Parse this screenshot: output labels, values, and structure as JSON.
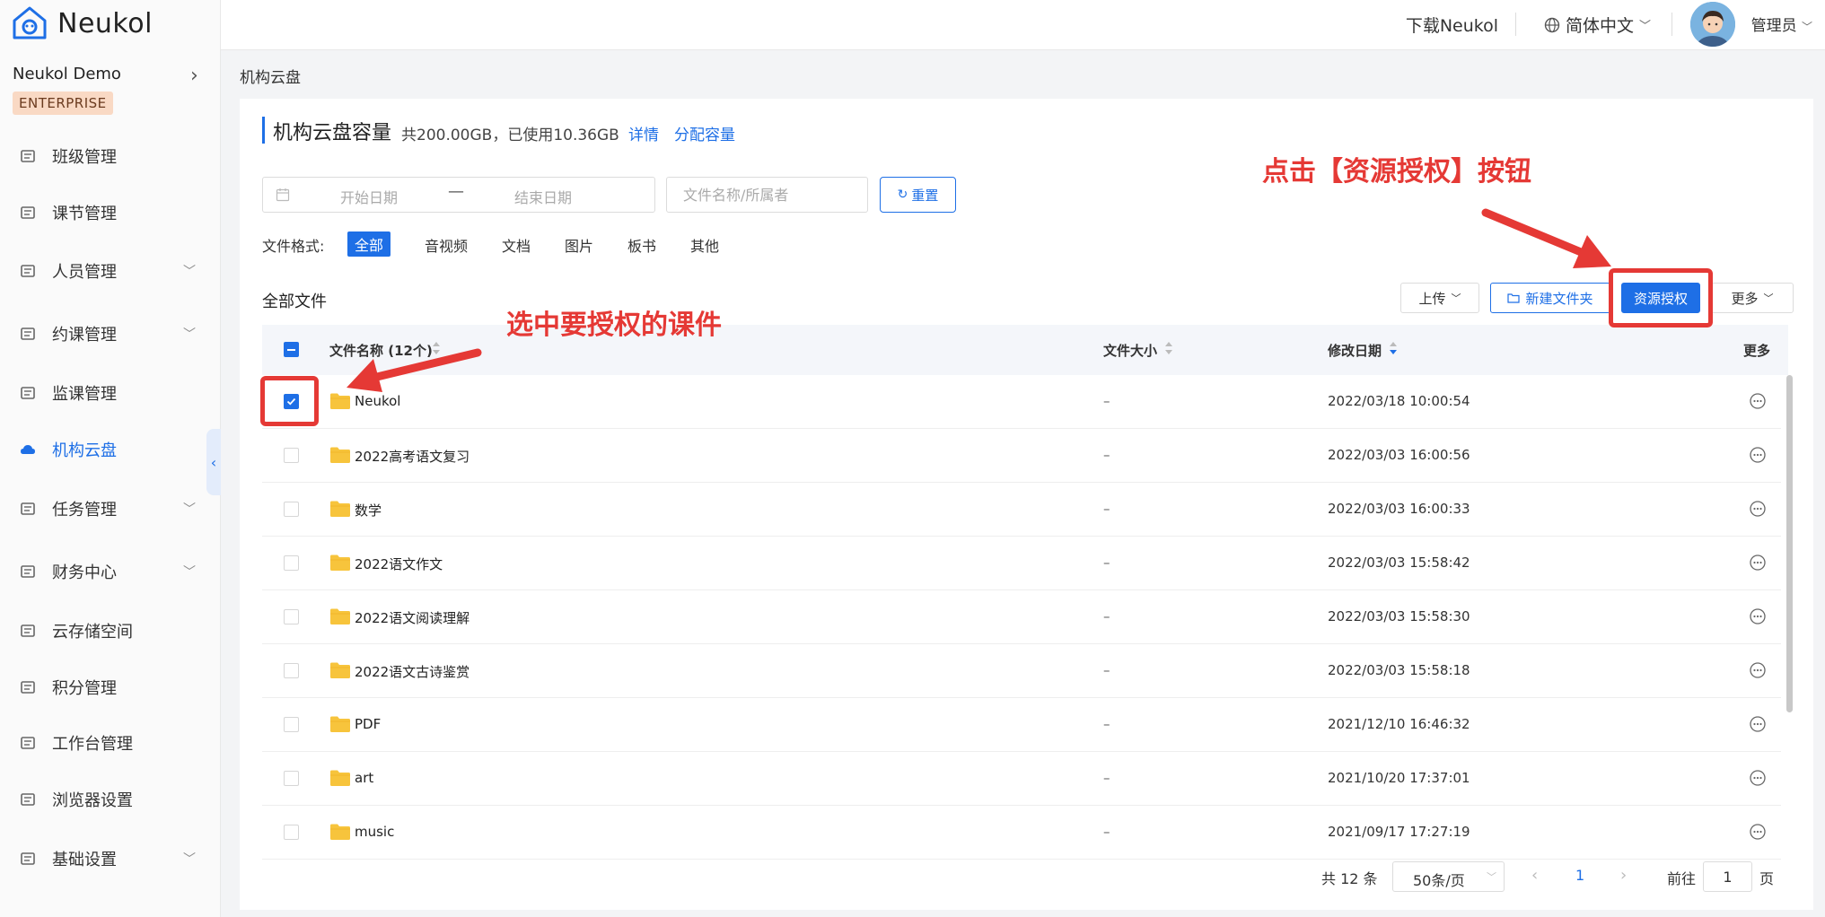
{
  "app": {
    "name": "Neukol",
    "org": "Neukol Demo",
    "plan_badge": "ENTERPRISE"
  },
  "sidebar": {
    "items": [
      {
        "label": "班级管理",
        "icon": "class-icon",
        "has_caret": false,
        "active": false
      },
      {
        "label": "课节管理",
        "icon": "lesson-icon",
        "has_caret": false,
        "active": false
      },
      {
        "label": "人员管理",
        "icon": "people-icon",
        "has_caret": true,
        "active": false
      },
      {
        "label": "约课管理",
        "icon": "booking-icon",
        "has_caret": true,
        "active": false
      },
      {
        "label": "监课管理",
        "icon": "monitor-icon",
        "has_caret": false,
        "active": false
      },
      {
        "label": "机构云盘",
        "icon": "cloud-icon",
        "has_caret": false,
        "active": true
      },
      {
        "label": "任务管理",
        "icon": "task-icon",
        "has_caret": true,
        "active": false
      },
      {
        "label": "财务中心",
        "icon": "finance-icon",
        "has_caret": true,
        "active": false
      },
      {
        "label": "云存储空间",
        "icon": "storage-icon",
        "has_caret": false,
        "active": false
      },
      {
        "label": "积分管理",
        "icon": "points-icon",
        "has_caret": false,
        "active": false
      },
      {
        "label": "工作台管理",
        "icon": "workbench-icon",
        "has_caret": false,
        "active": false
      },
      {
        "label": "浏览器设置",
        "icon": "browser-icon",
        "has_caret": false,
        "active": false
      },
      {
        "label": "基础设置",
        "icon": "settings-icon",
        "has_caret": true,
        "active": false
      }
    ]
  },
  "header": {
    "download": "下载Neukol",
    "language": "简体中文",
    "user": "管理员"
  },
  "breadcrumb": "机构云盘",
  "capacity": {
    "title": "机构云盘容量",
    "info": "共200.00GB，已使用10.36GB",
    "detail_link": "详情",
    "allocate_link": "分配容量"
  },
  "filters": {
    "start_placeholder": "开始日期",
    "end_placeholder": "结束日期",
    "name_placeholder": "文件名称/所属者",
    "reset": "重置",
    "format_label": "文件格式:",
    "formats": [
      "全部",
      "音视频",
      "文档",
      "图片",
      "板书",
      "其他"
    ],
    "active_format": "全部"
  },
  "toolbar": {
    "section_title": "全部文件",
    "upload": "上传",
    "new_folder": "新建文件夹",
    "authorize": "资源授权",
    "more": "更多"
  },
  "table": {
    "headers": {
      "name": "文件名称 (12个)",
      "size": "文件大小",
      "modified": "修改日期",
      "more": "更多"
    },
    "rows": [
      {
        "name": "Neukol",
        "size": "–",
        "modified": "2022/03/18 10:00:54",
        "checked": true
      },
      {
        "name": "2022高考语文复习",
        "size": "–",
        "modified": "2022/03/03 16:00:56",
        "checked": false
      },
      {
        "name": "数学",
        "size": "–",
        "modified": "2022/03/03 16:00:33",
        "checked": false
      },
      {
        "name": "2022语文作文",
        "size": "–",
        "modified": "2022/03/03 15:58:42",
        "checked": false
      },
      {
        "name": "2022语文阅读理解",
        "size": "–",
        "modified": "2022/03/03 15:58:30",
        "checked": false
      },
      {
        "name": "2022语文古诗鉴赏",
        "size": "–",
        "modified": "2022/03/03 15:58:18",
        "checked": false
      },
      {
        "name": "PDF",
        "size": "–",
        "modified": "2021/12/10 16:46:32",
        "checked": false
      },
      {
        "name": "art",
        "size": "–",
        "modified": "2021/10/20 17:37:01",
        "checked": false
      },
      {
        "name": "music",
        "size": "–",
        "modified": "2021/09/17 17:27:19",
        "checked": false
      }
    ]
  },
  "pagination": {
    "total": "共 12 条",
    "page_size": "50条/页",
    "current_page": "1",
    "goto_label": "前往",
    "goto_value": "1",
    "page_suffix": "页"
  },
  "annotations": {
    "click_authorize": "点击【资源授权】按钮",
    "select_course": "选中要授权的课件"
  },
  "colors": {
    "accent": "#1e6fe6",
    "annotation": "#e53935",
    "folder": "#f7c43c"
  }
}
